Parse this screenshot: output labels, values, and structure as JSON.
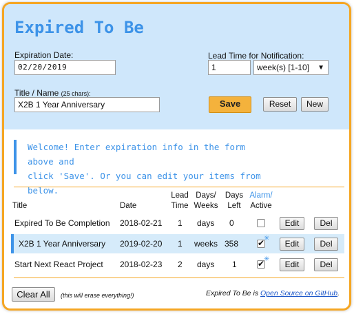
{
  "app": {
    "title": "Expired To Be"
  },
  "form": {
    "expiration_label": "Expiration Date:",
    "expiration_value": "02/20/2019",
    "lead_time_label": "Lead Time for Notification:",
    "lead_time_value": "1",
    "lead_unit_selected": "week(s) [1-10]",
    "name_label": "Title / Name",
    "name_hint": "(25 chars):",
    "name_value": "X2B 1 Year Anniversary",
    "save_label": "Save",
    "reset_label": "Reset",
    "new_label": "New"
  },
  "welcome": {
    "line1": "Welcome! Enter expiration info in the form above and",
    "line2": "click 'Save'. Or you can edit your items from below."
  },
  "table": {
    "headers": {
      "title": "Title",
      "date": "Date",
      "lead1": "Lead",
      "lead2": "Time",
      "days1": "Days/",
      "days2": "Weeks",
      "left1": "Days",
      "left2": "Left",
      "alarm1": "Alarm/",
      "alarm2": "Active"
    },
    "rows": [
      {
        "title": "Expired To Be Completion",
        "date": "2018-02-21",
        "lead": "1",
        "unit": "days",
        "left": "0",
        "active": false,
        "edit": "Edit",
        "del": "Del"
      },
      {
        "title": "X2B 1 Year Anniversary",
        "date": "2019-02-20",
        "lead": "1",
        "unit": "weeks",
        "left": "358",
        "active": true,
        "edit": "Edit",
        "del": "Del"
      },
      {
        "title": "Start Next React Project",
        "date": "2018-02-23",
        "lead": "2",
        "unit": "days",
        "left": "1",
        "active": true,
        "edit": "Edit",
        "del": "Del"
      }
    ]
  },
  "footer": {
    "clear_label": "Clear All",
    "clear_note": "(this will erase everything!)",
    "source_prefix": "Expired To Be is",
    "source_link": "Open Source on GitHub",
    "source_suffix": "."
  },
  "colors": {
    "accent": "#3d93e8",
    "border": "#f5a623",
    "save": "#f4b23c",
    "form_bg": "#cfe7fb"
  },
  "icons": {
    "caret": "caret-down-icon",
    "alarm": "alarm-sparkle-icon",
    "check": "checkmark-icon"
  }
}
